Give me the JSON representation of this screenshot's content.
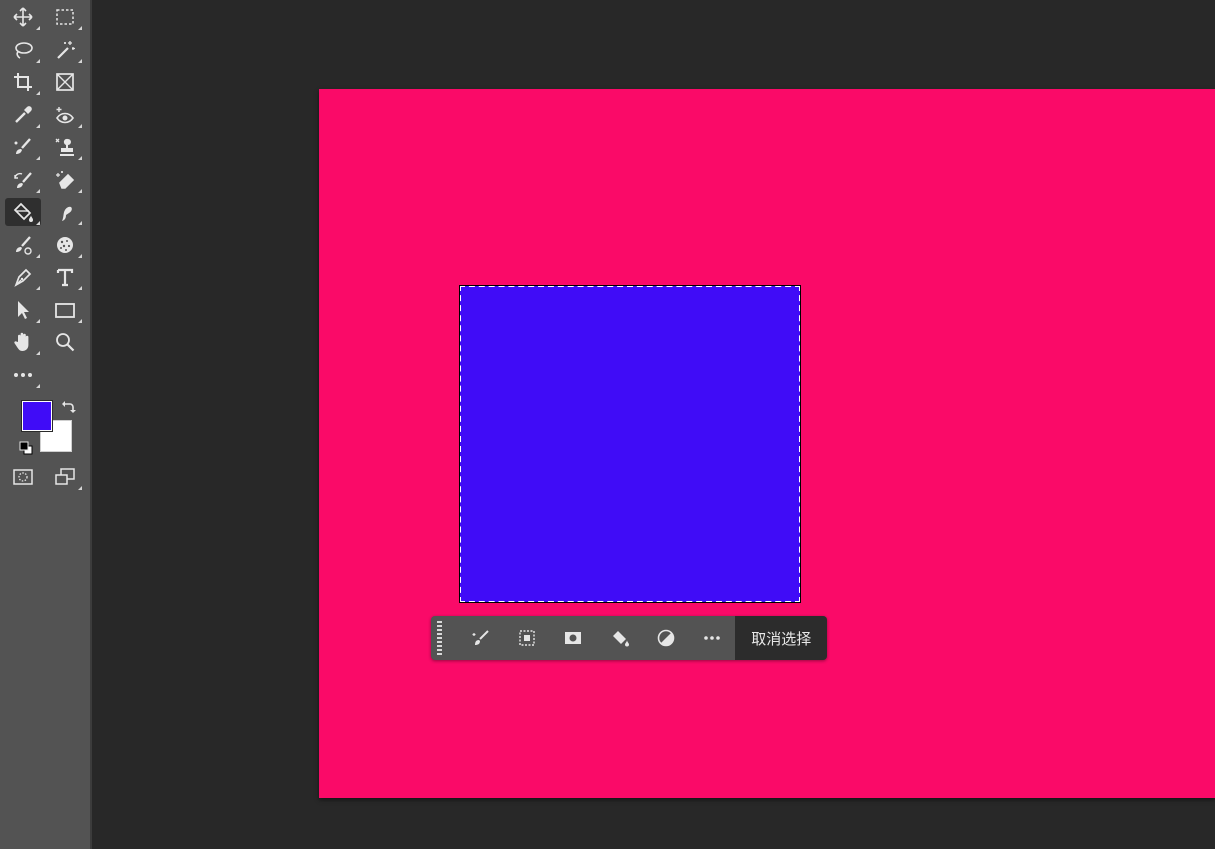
{
  "colors": {
    "canvas_background": "#fa0a68",
    "selection_fill": "#400cf7",
    "foreground": "#400cf7",
    "background": "#ffffff",
    "workspace": "#282828",
    "toolbar": "#535353"
  },
  "toolbar": {
    "tools": [
      {
        "name": "move-tool",
        "icon": "move-icon"
      },
      {
        "name": "rectangular-marquee-tool",
        "icon": "marquee-icon"
      },
      {
        "name": "lasso-tool",
        "icon": "lasso-icon"
      },
      {
        "name": "magic-wand-tool",
        "icon": "magic-wand-icon"
      },
      {
        "name": "crop-tool",
        "icon": "crop-icon"
      },
      {
        "name": "frame-tool",
        "icon": "frame-icon"
      },
      {
        "name": "eyedropper-tool",
        "icon": "eyedropper-icon"
      },
      {
        "name": "red-eye-tool",
        "icon": "red-eye-icon"
      },
      {
        "name": "healing-brush-tool",
        "icon": "healing-brush-icon"
      },
      {
        "name": "clone-stamp-tool",
        "icon": "stamp-icon"
      },
      {
        "name": "history-brush-tool",
        "icon": "history-brush-icon"
      },
      {
        "name": "eraser-tool",
        "icon": "eraser-icon"
      },
      {
        "name": "paint-bucket-tool",
        "icon": "paint-bucket-icon",
        "active": true
      },
      {
        "name": "smudge-tool",
        "icon": "smudge-icon"
      },
      {
        "name": "mixer-brush-tool",
        "icon": "mixer-brush-icon"
      },
      {
        "name": "sponge-tool",
        "icon": "sponge-icon"
      },
      {
        "name": "pen-tool",
        "icon": "pen-icon"
      },
      {
        "name": "type-tool",
        "icon": "type-icon"
      },
      {
        "name": "path-selection-tool",
        "icon": "arrow-icon"
      },
      {
        "name": "rectangle-tool",
        "icon": "rectangle-icon"
      },
      {
        "name": "hand-tool",
        "icon": "hand-icon"
      },
      {
        "name": "zoom-tool",
        "icon": "zoom-icon"
      },
      {
        "name": "edit-toolbar",
        "icon": "more-icon"
      },
      {
        "name": "quick-mask-mode",
        "icon": "quick-mask-icon"
      },
      {
        "name": "screen-mode",
        "icon": "screen-mode-icon"
      }
    ]
  },
  "contextual_taskbar": {
    "buttons": [
      {
        "name": "generative-fill-button",
        "icon": "brush-sparkle-icon"
      },
      {
        "name": "modify-selection-button",
        "icon": "modify-selection-icon"
      },
      {
        "name": "create-mask-button",
        "icon": "mask-icon"
      },
      {
        "name": "fill-selection-button",
        "icon": "paint-bucket-icon"
      },
      {
        "name": "adjustment-layer-button",
        "icon": "adjustment-icon"
      },
      {
        "name": "more-options-button",
        "icon": "more-icon"
      }
    ],
    "deselect_label": "取消选择"
  }
}
